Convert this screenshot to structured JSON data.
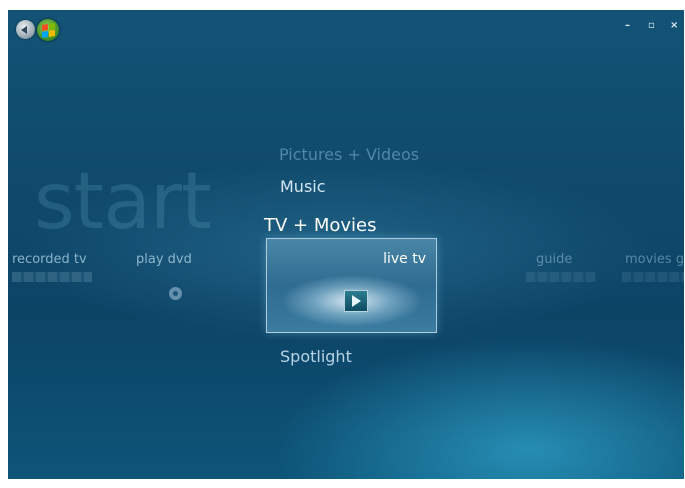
{
  "watermark": {
    "text": "start"
  },
  "window_controls": {
    "minimize": "–",
    "restore": "▫",
    "close": "×"
  },
  "menu": {
    "above_2": "Pictures + Videos",
    "above_1": "Music",
    "current": "TV + Movies",
    "below_1": "Spotlight"
  },
  "strip": {
    "items": [
      {
        "label": "recorded tv"
      },
      {
        "label": "play dvd"
      },
      {
        "label": "live tv",
        "selected": true
      },
      {
        "label": "guide"
      },
      {
        "label": "movies g"
      }
    ]
  },
  "colors": {
    "background": "#0f4a6c",
    "accent_glow": "#3cbee6",
    "start_orb": "#3f8f27"
  },
  "icons": {
    "back": "back-arrow-icon",
    "start": "windows-logo-icon",
    "dvd": "disc-icon",
    "live_tv": "play-icon"
  }
}
